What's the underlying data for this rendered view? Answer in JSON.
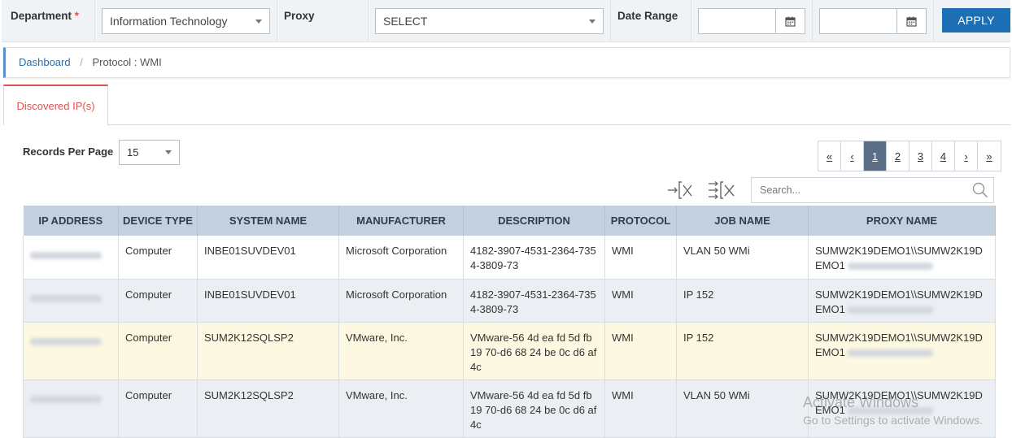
{
  "filters": {
    "department_label": "Department",
    "department_required": "*",
    "department_value": "Information Technology",
    "proxy_label": "Proxy",
    "proxy_value": "SELECT",
    "date_range_label": "Date Range",
    "apply_label": "APPLY"
  },
  "breadcrumb": {
    "home": "Dashboard",
    "separator": "/",
    "current": "Protocol : WMI"
  },
  "tabs": [
    {
      "label": "Discovered IP(s)",
      "active": true
    }
  ],
  "records_per_page": {
    "label": "Records Per Page",
    "value": "15"
  },
  "pagination": {
    "first": "«",
    "prev": "‹",
    "pages": [
      "1",
      "2",
      "3",
      "4"
    ],
    "current": "1",
    "next": "›",
    "last": "»"
  },
  "search": {
    "placeholder": "Search..."
  },
  "table": {
    "headers": [
      "IP ADDRESS",
      "DEVICE TYPE",
      "SYSTEM NAME",
      "MANUFACTURER",
      "DESCRIPTION",
      "PROTOCOL",
      "JOB NAME",
      "PROXY NAME"
    ],
    "rows": [
      {
        "device_type": "Computer",
        "system_name": "INBE01SUVDEV01",
        "manufacturer": "Microsoft Corporation",
        "description": "4182-3907-4531-2364-7354-3809-73",
        "protocol": "WMI",
        "job_name": "VLAN 50 WMi",
        "proxy_name": "SUMW2K19DEMO1\\\\SUMW2K19DEMO1"
      },
      {
        "device_type": "Computer",
        "system_name": "INBE01SUVDEV01",
        "manufacturer": "Microsoft Corporation",
        "description": "4182-3907-4531-2364-7354-3809-73",
        "protocol": "WMI",
        "job_name": "IP 152",
        "proxy_name": "SUMW2K19DEMO1\\\\SUMW2K19DEMO1"
      },
      {
        "device_type": "Computer",
        "system_name": "SUM2K12SQLSP2",
        "manufacturer": "VMware, Inc.",
        "description": "VMware-56 4d ea fd 5d fb 19 70-d6 68 24 be 0c d6 af 4c",
        "protocol": "WMI",
        "job_name": "IP 152",
        "proxy_name": "SUMW2K19DEMO1\\\\SUMW2K19DEMO1"
      },
      {
        "device_type": "Computer",
        "system_name": "SUM2K12SQLSP2",
        "manufacturer": "VMware, Inc.",
        "description": "VMware-56 4d ea fd 5d fb 19 70-d6 68 24 be 0c d6 af 4c",
        "protocol": "WMI",
        "job_name": "VLAN 50 WMi",
        "proxy_name": "SUMW2K19DEMO1\\\\SUMW2K19DEMO1"
      }
    ]
  },
  "watermark": {
    "line1": "Activate Windows",
    "line2": "Go to Settings to activate Windows."
  },
  "icons": {
    "calendar": "calendar-icon",
    "search": "search-icon",
    "export": "export-columns-icon",
    "columns": "column-filter-icon"
  },
  "colors": {
    "apply_button": "#1c6fb5",
    "active_tab": "#d9534f",
    "pager_active": "#5a6e87",
    "table_header": "#c3d0dd",
    "highlight_row": "#fcf8e1"
  }
}
